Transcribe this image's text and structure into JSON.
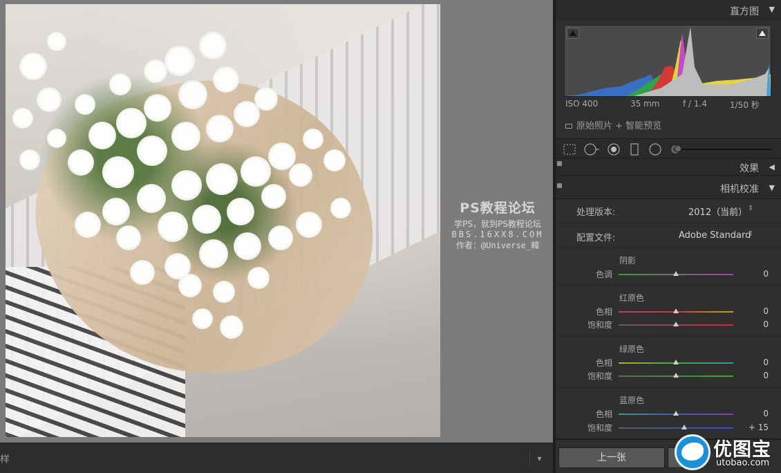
{
  "canvas": {
    "watermark": {
      "title": "PS教程论坛",
      "subtitle": "学PS，就到PS教程论坛",
      "url": "BBS.16XX8.COM",
      "author": "作者：@Universe_韓"
    }
  },
  "bottombar": {
    "left_label": "样",
    "dropdown_icon": "chevron-down-icon"
  },
  "panel": {
    "histogram": {
      "title": "直方图",
      "exif": {
        "iso": "ISO 400",
        "focal": "35 mm",
        "aperture": "f / 1.4",
        "shutter": "1/50 秒"
      },
      "smart_preview": "原始照片 + 智能预览"
    },
    "tools": [
      "crop-icon",
      "spot-removal-icon",
      "red-eye-icon",
      "graduated-filter-icon",
      "radial-filter-icon",
      "brush-icon"
    ],
    "effects": {
      "title": "效果"
    },
    "camera_calibration": {
      "title": "相机校准",
      "process_label": "处理版本:",
      "process_value": "2012（当前）",
      "profile_label": "配置文件:",
      "profile_value": "Adobe Standard",
      "shadows": {
        "title": "阴影",
        "tint_label": "色调",
        "tint_value": "0"
      },
      "red": {
        "title": "红原色",
        "hue_label": "色相",
        "hue_value": "0",
        "sat_label": "饱和度",
        "sat_value": "0"
      },
      "green": {
        "title": "绿原色",
        "hue_label": "色相",
        "hue_value": "0",
        "sat_label": "饱和度",
        "sat_value": "0"
      },
      "blue": {
        "title": "蓝原色",
        "hue_label": "色相",
        "hue_value": "0",
        "sat_label": "饱和度",
        "sat_value": "+ 15"
      }
    },
    "prev_button": "上一张"
  },
  "logo": {
    "name": "优图宝",
    "url": "utobao.com"
  }
}
